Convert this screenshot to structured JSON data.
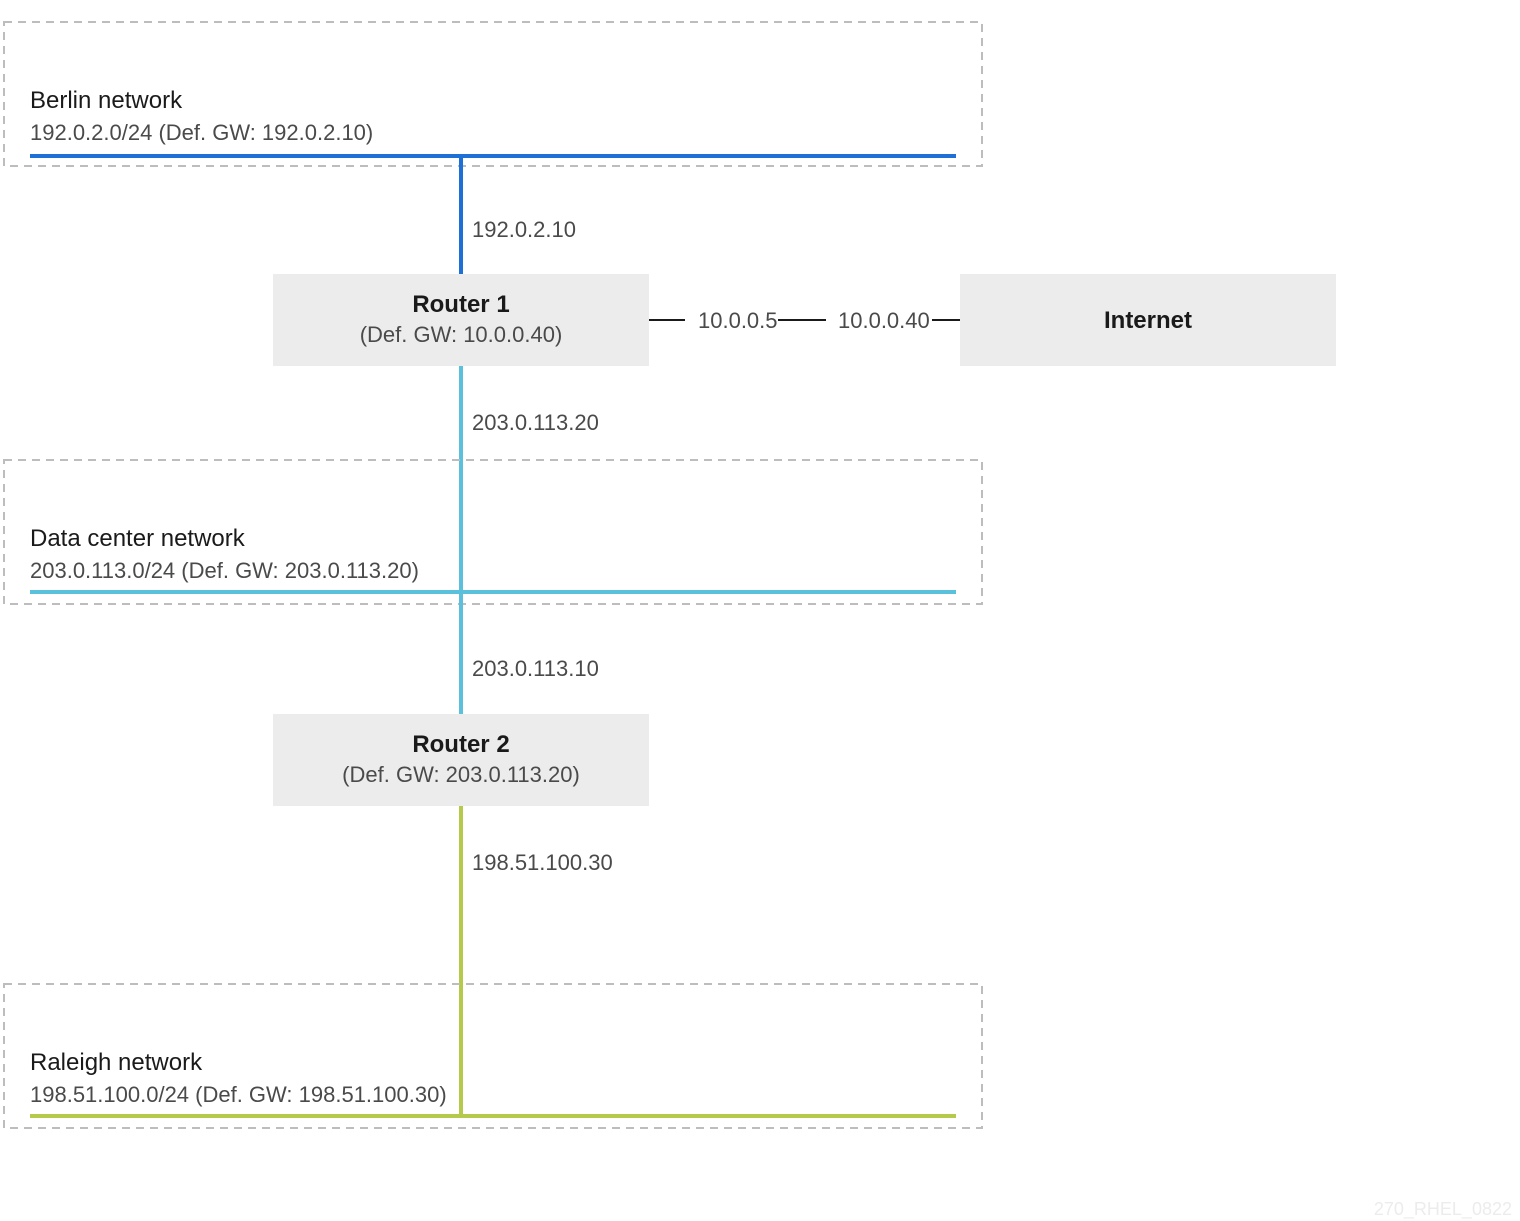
{
  "colors": {
    "blue": "#1e6fd6",
    "teal": "#5ac0dc",
    "olive": "#b5c94a"
  },
  "networks": {
    "berlin": {
      "title": "Berlin network",
      "subnet": "192.0.2.0/24  (Def. GW: 192.0.2.10)"
    },
    "datacenter": {
      "title": "Data center network",
      "subnet": "203.0.113.0/24  (Def. GW: 203.0.113.20)"
    },
    "raleigh": {
      "title": "Raleigh network",
      "subnet": "198.51.100.0/24  (Def. GW: 198.51.100.30)"
    }
  },
  "nodes": {
    "router1": {
      "title": "Router 1",
      "sub": "(Def. GW: 10.0.0.40)"
    },
    "router2": {
      "title": "Router 2",
      "sub": "(Def. GW: 203.0.113.20)"
    },
    "internet": {
      "title": "Internet"
    }
  },
  "links": {
    "r1_up_ip": "192.0.2.10",
    "r1_down_ip": "203.0.113.20",
    "r2_up_ip": "203.0.113.10",
    "r2_down_ip": "198.51.100.30",
    "r1_r_ip": "10.0.0.5",
    "inet_l_ip": "10.0.0.40"
  },
  "watermark": "270_RHEL_0822"
}
